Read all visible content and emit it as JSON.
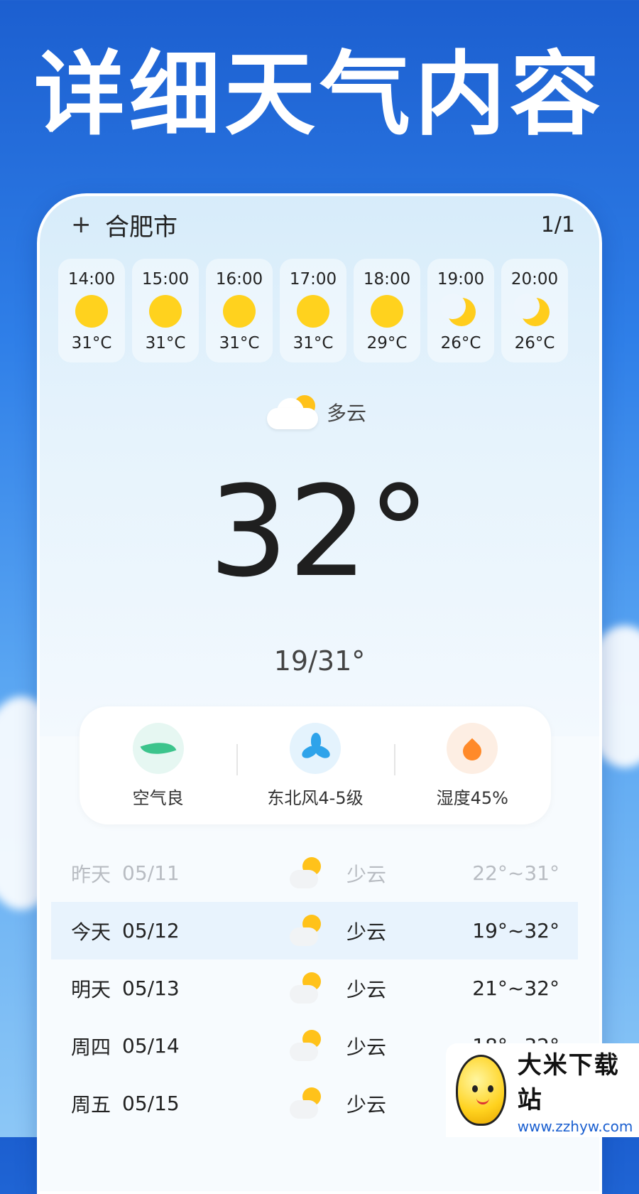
{
  "headline": "详细天气内容",
  "topbar": {
    "add_icon": "+",
    "city": "合肥市",
    "page_indicator": "1/1"
  },
  "hourly": [
    {
      "time": "14:00",
      "icon": "sun-icon",
      "temp": "31°C"
    },
    {
      "time": "15:00",
      "icon": "sun-icon",
      "temp": "31°C"
    },
    {
      "time": "16:00",
      "icon": "sun-icon",
      "temp": "31°C"
    },
    {
      "time": "17:00",
      "icon": "sun-icon",
      "temp": "31°C"
    },
    {
      "time": "18:00",
      "icon": "sun-icon",
      "temp": "29°C"
    },
    {
      "time": "19:00",
      "icon": "moon-icon",
      "temp": "26°C"
    },
    {
      "time": "20:00",
      "icon": "moon-icon",
      "temp": "26°C"
    }
  ],
  "current": {
    "condition": "多云",
    "temp": "32°",
    "range": "19/31°"
  },
  "metrics": [
    {
      "icon": "leaf-icon",
      "label": "空气良"
    },
    {
      "icon": "fan-icon",
      "label": "东北风4-5级"
    },
    {
      "icon": "water-drop-icon",
      "label": "湿度45%"
    }
  ],
  "daily": [
    {
      "name": "昨天",
      "date": "05/11",
      "icon": "partly-cloudy-icon",
      "cond": "少云",
      "range": "22°~31°"
    },
    {
      "name": "今天",
      "date": "05/12",
      "icon": "partly-cloudy-icon",
      "cond": "少云",
      "range": "19°~32°"
    },
    {
      "name": "明天",
      "date": "05/13",
      "icon": "partly-cloudy-icon",
      "cond": "少云",
      "range": "21°~32°"
    },
    {
      "name": "周四",
      "date": "05/14",
      "icon": "partly-cloudy-icon",
      "cond": "少云",
      "range": "18°~32°"
    },
    {
      "name": "周五",
      "date": "05/15",
      "icon": "partly-cloudy-icon",
      "cond": "少云",
      "range": ""
    }
  ],
  "watermark": {
    "name": "大米下载站",
    "url": "www.zzhyw.com"
  },
  "colors": {
    "sun": "#ffd21e",
    "brand_blue": "#1c5fd0",
    "today_highlight": "#e8f3fd"
  }
}
